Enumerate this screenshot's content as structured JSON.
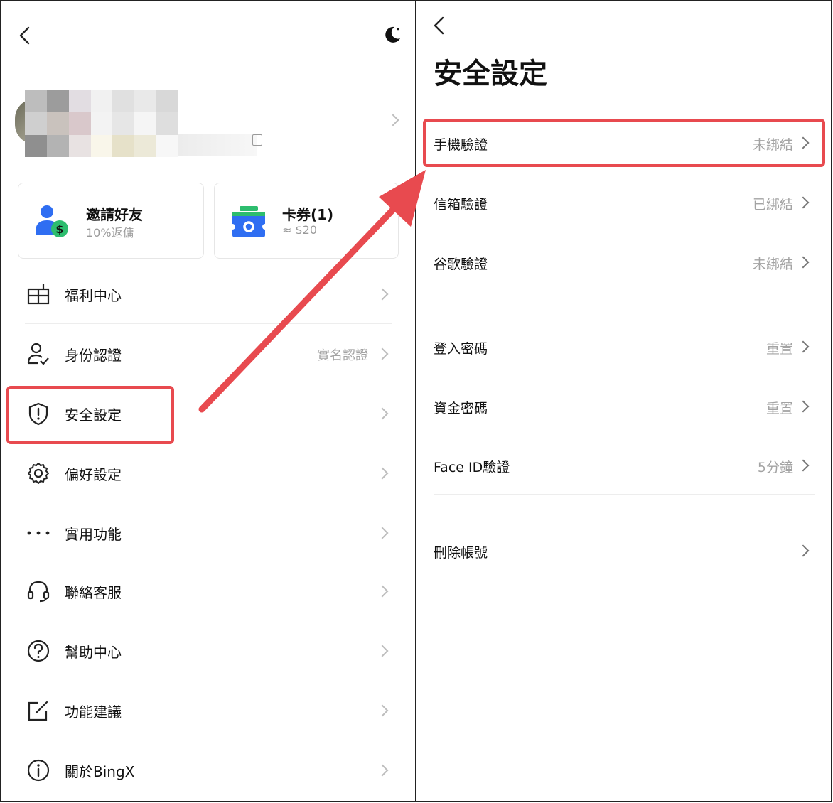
{
  "left": {
    "cards": [
      {
        "title": "邀請好友",
        "subtitle": "10%返傭"
      },
      {
        "title": "卡券(1)",
        "subtitle": "≈ $20"
      }
    ],
    "menu": [
      {
        "label": "福利中心",
        "right": ""
      },
      {
        "label": "身份認證",
        "right": "實名認證"
      },
      {
        "label": "安全設定",
        "right": ""
      },
      {
        "label": "偏好設定",
        "right": ""
      },
      {
        "label": "實用功能",
        "right": ""
      },
      {
        "label": "聯絡客服",
        "right": ""
      },
      {
        "label": "幫助中心",
        "right": ""
      },
      {
        "label": "功能建議",
        "right": ""
      },
      {
        "label": "關於BingX",
        "right": ""
      }
    ]
  },
  "right": {
    "title": "安全設定",
    "rows": [
      {
        "label": "手機驗證",
        "value": "未綁結"
      },
      {
        "label": "信箱驗證",
        "value": "已綁結"
      },
      {
        "label": "谷歌驗證",
        "value": "未綁結"
      },
      {
        "label": "登入密碼",
        "value": "重置"
      },
      {
        "label": "資金密碼",
        "value": "重置"
      },
      {
        "label": "Face ID驗證",
        "value": "5分鐘"
      },
      {
        "label": "刪除帳號",
        "value": ""
      }
    ]
  },
  "colors": {
    "highlight": "#e84a4f",
    "invite_blue": "#2f6ef2",
    "invite_green": "#2dbd6e",
    "voucher_blue": "#2f6ef2",
    "voucher_green": "#2dbd6e"
  }
}
